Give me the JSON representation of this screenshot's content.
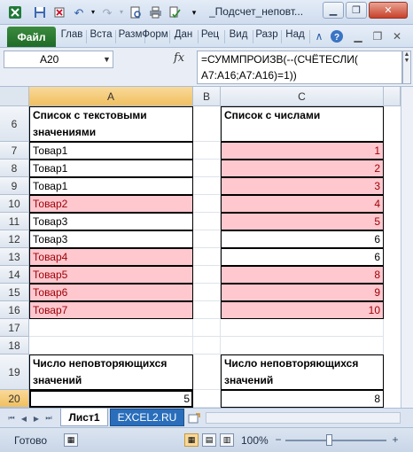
{
  "title_bar": {
    "title": "_Подсчет_неповт...",
    "minimize_icon": "minimize-icon",
    "restore_icon": "restore-icon",
    "close_icon": "close-icon"
  },
  "ribbon": {
    "file_tab": "Файл",
    "tabs": [
      "Глав",
      "Вста",
      "Разм",
      "Форм",
      "Дан",
      "Рец",
      "Вид",
      "Разр",
      "Над"
    ]
  },
  "formula_bar": {
    "name_box": "A20",
    "fx_label": "fx",
    "formula": "=СУММПРОИЗВ(--(СЧЁТЕСЛИ(\nA7:A16;A7:A16)=1))"
  },
  "columns": [
    "A",
    "B",
    "C"
  ],
  "rows": [
    {
      "num": "6",
      "a": "Список с текстовыми\nзначениями",
      "c": "Список с числами",
      "header": true
    },
    {
      "num": "7",
      "a": "Товар1",
      "c": "1",
      "a_dup": false,
      "c_dup": true
    },
    {
      "num": "8",
      "a": "Товар1",
      "c": "2",
      "a_dup": false,
      "c_dup": true
    },
    {
      "num": "9",
      "a": "Товар1",
      "c": "3",
      "a_dup": false,
      "c_dup": true
    },
    {
      "num": "10",
      "a": "Товар2",
      "c": "4",
      "a_dup": true,
      "c_dup": true
    },
    {
      "num": "11",
      "a": "Товар3",
      "c": "5",
      "a_dup": false,
      "c_dup": true
    },
    {
      "num": "12",
      "a": "Товар3",
      "c": "6",
      "a_dup": false,
      "c_dup": false
    },
    {
      "num": "13",
      "a": "Товар4",
      "c": "6",
      "a_dup": true,
      "c_dup": false
    },
    {
      "num": "14",
      "a": "Товар5",
      "c": "8",
      "a_dup": true,
      "c_dup": true
    },
    {
      "num": "15",
      "a": "Товар6",
      "c": "9",
      "a_dup": true,
      "c_dup": true
    },
    {
      "num": "16",
      "a": "Товар7",
      "c": "10",
      "a_dup": true,
      "c_dup": true
    },
    {
      "num": "17",
      "a": "",
      "c": ""
    },
    {
      "num": "18",
      "a": "",
      "c": ""
    },
    {
      "num": "19",
      "a": "Число неповторяющихся\nзначений",
      "c": "Число неповторяющихся\nзначений",
      "header": true
    },
    {
      "num": "20",
      "a": "5",
      "c": "8",
      "result": true
    }
  ],
  "sheet_tabs": {
    "active": "Лист1",
    "other": "EXCEL2.RU"
  },
  "status_bar": {
    "status": "Готово",
    "zoom": "100%",
    "zoom_minus": "−",
    "zoom_plus": "+"
  },
  "colors": {
    "duplicate_fill": "#ffc7ce",
    "duplicate_text": "#9c0006",
    "file_tab": "#2a7a30",
    "selection_header": "#f0c060"
  }
}
